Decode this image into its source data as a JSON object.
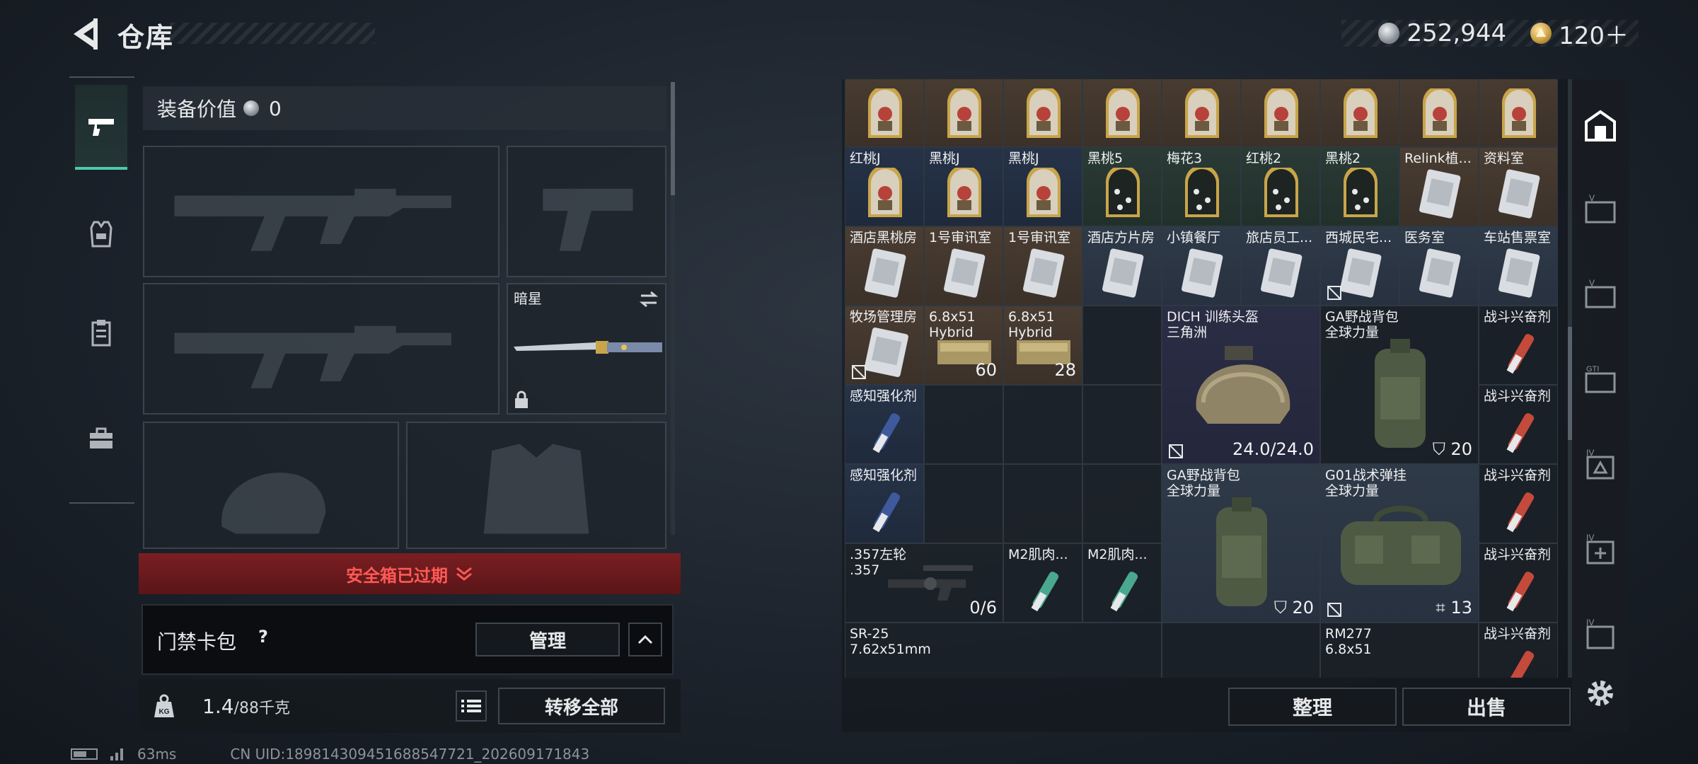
{
  "header": {
    "title": "仓库",
    "currency_silver": "252,944",
    "currency_gold": "120＋"
  },
  "left_tabs": [
    {
      "name": "firearms",
      "icon": "pistol-icon",
      "active": true
    },
    {
      "name": "armor",
      "icon": "vest-icon",
      "active": false
    },
    {
      "name": "consumables",
      "icon": "clipboard-icon",
      "active": false
    },
    {
      "name": "toolbox",
      "icon": "toolbox-icon",
      "active": false
    }
  ],
  "loadout": {
    "equip_value_label": "装备价值",
    "equip_value": "0",
    "melee_name": "暗星",
    "safebox_status": "安全箱已过期",
    "keycard_label": "门禁卡包",
    "keycard_help": "?",
    "manage_label": "管理",
    "weight_current": "1.4",
    "weight_max": "/88千克",
    "kg_label": "KG",
    "transfer_all_label": "转移全部"
  },
  "status_bar": {
    "ping": "63ms",
    "uid": "CN UID:189814309451688547721_202609171843"
  },
  "inventory": {
    "row0": [
      {
        "label": "",
        "bg": "bg-brown",
        "icon": "card-icon"
      },
      {
        "label": "",
        "bg": "bg-brown",
        "icon": "card-icon"
      },
      {
        "label": "",
        "bg": "bg-brown",
        "icon": "card-icon"
      },
      {
        "label": "",
        "bg": "bg-brown",
        "icon": "card-icon"
      },
      {
        "label": "",
        "bg": "bg-brown",
        "icon": "card-icon"
      },
      {
        "label": "",
        "bg": "bg-brown",
        "icon": "card-icon"
      },
      {
        "label": "",
        "bg": "bg-brown",
        "icon": "card-icon"
      },
      {
        "label": "",
        "bg": "bg-brown",
        "icon": "card-icon"
      },
      {
        "label": "",
        "bg": "bg-brown",
        "icon": "card-icon"
      }
    ],
    "row1": [
      {
        "label": "红桃J",
        "bg": "bg-navy",
        "icon": "card-icon"
      },
      {
        "label": "黑桃J",
        "bg": "bg-navy",
        "icon": "card-icon"
      },
      {
        "label": "黑桃J",
        "bg": "bg-navy",
        "icon": "card-icon"
      },
      {
        "label": "黑桃5",
        "bg": "bg-green",
        "icon": "dark-card-icon"
      },
      {
        "label": "梅花3",
        "bg": "bg-green",
        "icon": "dark-card-icon"
      },
      {
        "label": "红桃2",
        "bg": "bg-green",
        "icon": "dark-card-icon"
      },
      {
        "label": "黑桃2",
        "bg": "bg-green",
        "icon": "dark-card-icon"
      },
      {
        "label": "Relink植...",
        "bg": "bg-brown",
        "icon": "keycard-icon"
      },
      {
        "label": "资料室",
        "bg": "bg-brown",
        "icon": "keycard-icon"
      }
    ],
    "row2": [
      {
        "label": "酒店黑桃房",
        "bg": "bg-brown",
        "icon": "keycard-icon"
      },
      {
        "label": "1号审讯室",
        "bg": "bg-brown",
        "icon": "keycard-icon"
      },
      {
        "label": "1号审讯室",
        "bg": "bg-brown",
        "icon": "keycard-icon"
      },
      {
        "label": "酒店方片房",
        "bg": "bg-slate",
        "icon": "keycard-icon"
      },
      {
        "label": "小镇餐厅",
        "bg": "bg-slate",
        "icon": "keycard-icon"
      },
      {
        "label": "旅店员工...",
        "bg": "bg-slate",
        "icon": "keycard-icon"
      },
      {
        "label": "西城民宅...",
        "bg": "bg-slate",
        "icon": "keycard-icon"
      },
      {
        "label": "医务室",
        "bg": "bg-slate",
        "icon": "keycard-icon"
      },
      {
        "label": "车站售票室",
        "bg": "bg-slate",
        "icon": "keycard-icon"
      }
    ],
    "ammo": [
      {
        "label": "6.8x51",
        "sub": "Hybrid",
        "count": "60"
      },
      {
        "label": "6.8x51",
        "sub": "Hybrid",
        "count": "28"
      }
    ],
    "helmet": {
      "label": "DICH 训练头盔",
      "sub": "三角洲",
      "durability": "24.0/24.0"
    },
    "backpack1": {
      "label": "GA野战背包",
      "sub": "全球力量",
      "capacity": "20"
    },
    "backpack2": {
      "label": "GA野战背包",
      "sub": "全球力量",
      "capacity": "20"
    },
    "rig": {
      "label": "G01战术弹挂",
      "sub": "全球力量",
      "capacity": "13"
    },
    "key_bottom": {
      "label": "牧场管理房"
    },
    "stim_blue": [
      {
        "label": "感知强化剂"
      },
      {
        "label": "感知强化剂"
      }
    ],
    "stim_red": [
      {
        "label": "战斗兴奋剂"
      },
      {
        "label": "战斗兴奋剂"
      },
      {
        "label": "战斗兴奋剂"
      },
      {
        "label": "战斗兴奋剂"
      },
      {
        "label": "战斗兴奋剂"
      }
    ],
    "revolver": {
      "label": ".357左轮",
      "sub": ".357",
      "count": "0/6"
    },
    "m2": [
      {
        "label": "M2肌肉..."
      },
      {
        "label": "M2肌肉..."
      }
    ],
    "sr25": {
      "label": "SR-25",
      "sub": "7.62x51mm"
    },
    "rm277": {
      "label": "RM277",
      "sub": "6.8x51"
    },
    "sort_label": "整理",
    "sell_label": "出售"
  },
  "colors": {
    "accent_green": "#4fc9a6",
    "warning_red": "#ff5a55"
  }
}
